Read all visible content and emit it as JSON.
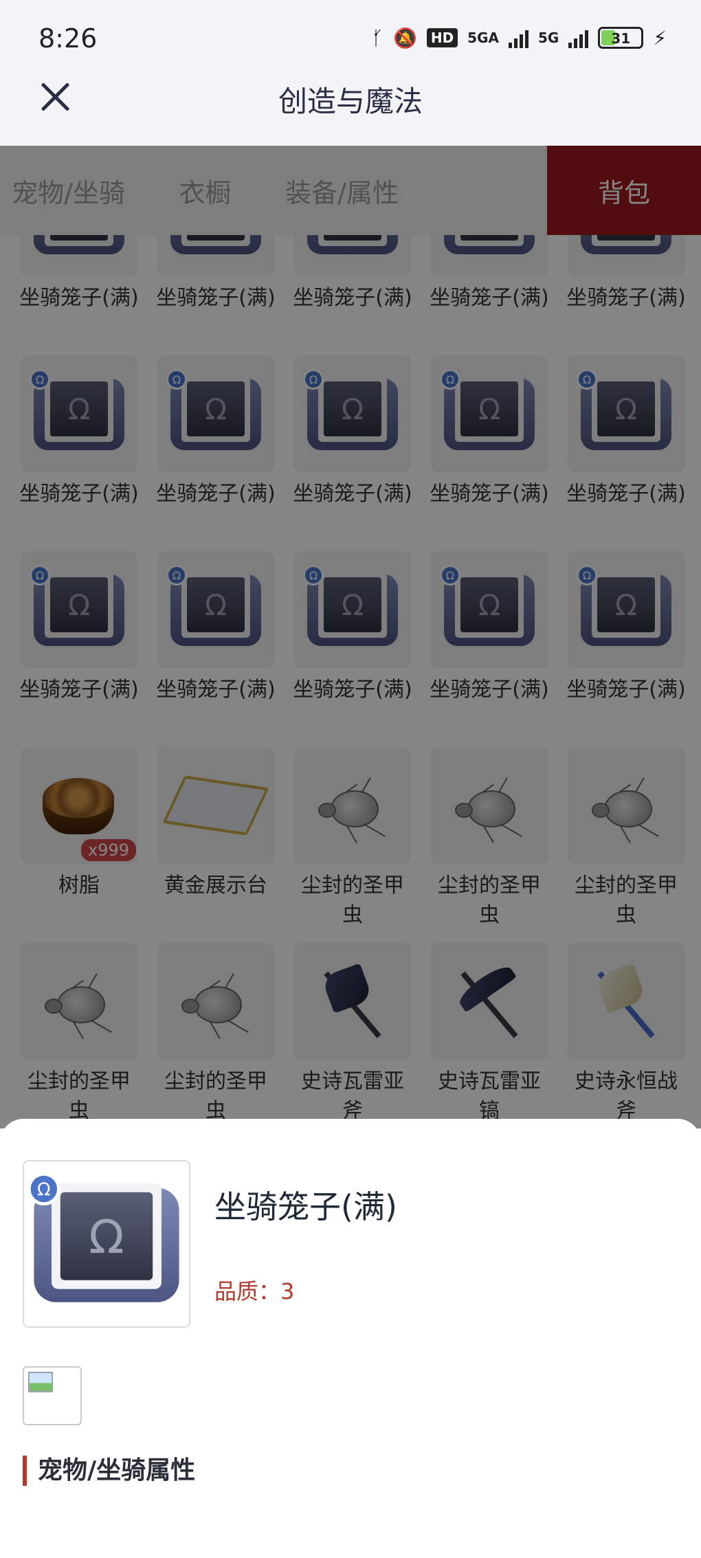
{
  "status_bar": {
    "time": "8:26",
    "hd": "HD",
    "signal1": "5GA",
    "signal2": "5G",
    "battery": "31"
  },
  "header": {
    "title": "创造与魔法"
  },
  "tabs": [
    {
      "label": "宠物/坐骑",
      "active": false
    },
    {
      "label": "衣橱",
      "active": false
    },
    {
      "label": "装备/属性",
      "active": false
    },
    {
      "label": "背包",
      "active": true
    }
  ],
  "grid": {
    "items": [
      {
        "name": "坐骑笼子(满)",
        "icon": "mount-cage-icon"
      },
      {
        "name": "坐骑笼子(满)",
        "icon": "mount-cage-icon"
      },
      {
        "name": "坐骑笼子(满)",
        "icon": "mount-cage-icon"
      },
      {
        "name": "坐骑笼子(满)",
        "icon": "mount-cage-icon"
      },
      {
        "name": "坐骑笼子(满)",
        "icon": "mount-cage-icon"
      },
      {
        "name": "坐骑笼子(满)",
        "icon": "mount-cage-icon"
      },
      {
        "name": "坐骑笼子(满)",
        "icon": "mount-cage-icon"
      },
      {
        "name": "坐骑笼子(满)",
        "icon": "mount-cage-icon"
      },
      {
        "name": "坐骑笼子(满)",
        "icon": "mount-cage-icon"
      },
      {
        "name": "坐骑笼子(满)",
        "icon": "mount-cage-icon"
      },
      {
        "name": "坐骑笼子(满)",
        "icon": "mount-cage-icon"
      },
      {
        "name": "坐骑笼子(满)",
        "icon": "mount-cage-icon"
      },
      {
        "name": "坐骑笼子(满)",
        "icon": "mount-cage-icon"
      },
      {
        "name": "坐骑笼子(满)",
        "icon": "mount-cage-icon"
      },
      {
        "name": "坐骑笼子(满)",
        "icon": "mount-cage-icon"
      },
      {
        "name": "树脂",
        "icon": "resin-icon",
        "qty": "x999"
      },
      {
        "name": "黄金展示台",
        "icon": "display-stand-icon"
      },
      {
        "name": "尘封的圣甲虫",
        "icon": "beetle-icon"
      },
      {
        "name": "尘封的圣甲虫",
        "icon": "beetle-icon"
      },
      {
        "name": "尘封的圣甲虫",
        "icon": "beetle-icon"
      },
      {
        "name": "尘封的圣甲虫",
        "icon": "beetle-icon"
      },
      {
        "name": "尘封的圣甲虫",
        "icon": "beetle-icon"
      },
      {
        "name": "史诗瓦雷亚斧",
        "icon": "axe-icon"
      },
      {
        "name": "史诗瓦雷亚镐",
        "icon": "pickaxe-icon"
      },
      {
        "name": "史诗永恒战斧",
        "icon": "battle-axe-icon"
      }
    ]
  },
  "detail": {
    "name": "坐骑笼子(满)",
    "quality": "品质：3",
    "section_title": "宠物/坐骑属性"
  }
}
